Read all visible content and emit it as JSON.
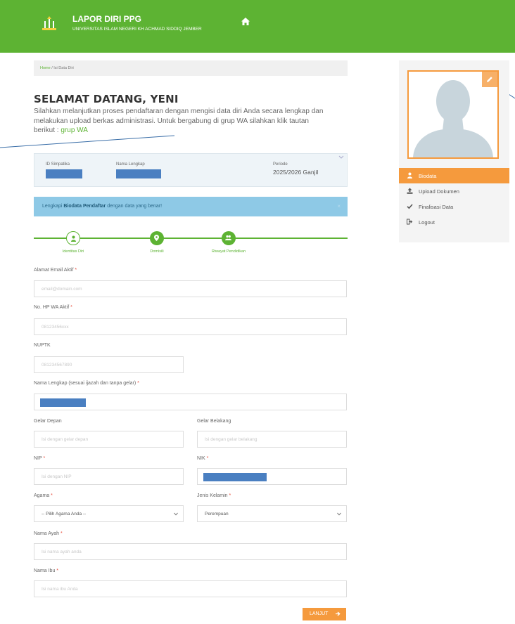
{
  "header": {
    "title": "LAPOR DIRI PPG",
    "subtitle": "UNIVERSITAS ISLAM NEGERI KH ACHMAD SIDDIQ JEMBER"
  },
  "breadcrumb": {
    "home": "Home",
    "current": "Isi Data Diri"
  },
  "welcome": {
    "title": "SELAMAT DATANG, YENI",
    "text": "Silahkan melanjutkan proses pendaftaran dengan mengisi data diri Anda secara lengkap dan melakukan upload berkas administrasi. Untuk bergabung di grup WA silahkan klik tautan berikut : ",
    "link": "grup WA"
  },
  "info": {
    "id_label": "ID Simpatika",
    "name_label": "Nama Lengkap",
    "period_label": "Periode",
    "period_value": "2025/2026 Ganjil"
  },
  "alert": {
    "pre": "Lengkapi ",
    "bold": "Biodata Pendaftar",
    "post": " dengan data yang benar!",
    "close": "×"
  },
  "steps": [
    {
      "label": "Identitas Diri"
    },
    {
      "label": "Domisili"
    },
    {
      "label": "Riwayat Pendidikan"
    }
  ],
  "form": {
    "email": {
      "label": "Alamat Email Aktif ",
      "placeholder": "email@domain.com"
    },
    "hp": {
      "label": "No. HP WA Aktif ",
      "placeholder": "08123456xxx"
    },
    "nuptk": {
      "label": "NUPTK",
      "placeholder": "081234567890"
    },
    "nama": {
      "label": "Nama Lengkap (sesuai ijazah dan tanpa gelar) "
    },
    "gelar_depan": {
      "label": "Gelar Depan",
      "placeholder": "Isi dengan gelar depan"
    },
    "gelar_belakang": {
      "label": "Gelar Belakang",
      "placeholder": "Isi dengan gelar belakang"
    },
    "nip": {
      "label": "NIP ",
      "placeholder": "Isi dengan NIP"
    },
    "nik": {
      "label": "NIK "
    },
    "agama": {
      "label": "Agama ",
      "value": "-- Pilih Agama Anda --"
    },
    "jk": {
      "label": "Jenis Kelamin ",
      "value": "Perempuan"
    },
    "ayah": {
      "label": "Nama Ayah ",
      "placeholder": "Isi nama ayah anda"
    },
    "ibu": {
      "label": "Nama Ibu ",
      "placeholder": "Isi nama ibu Anda"
    },
    "req": "*",
    "next": "LANJUT"
  },
  "sidebar": {
    "items": [
      {
        "label": "Biodata"
      },
      {
        "label": "Upload Dokumen"
      },
      {
        "label": "Finalisasi Data"
      },
      {
        "label": "Logout"
      }
    ]
  },
  "colors": {
    "primary": "#5db333",
    "accent": "#f59a3d",
    "info": "#8ec9e6",
    "mask": "#4a7fc1"
  }
}
